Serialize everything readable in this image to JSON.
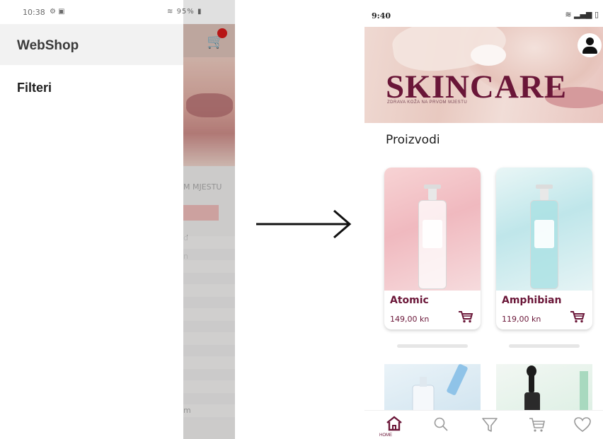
{
  "left_phone": {
    "status": {
      "time": "10:38",
      "right": "95%"
    },
    "drawer": {
      "title": "WebShop",
      "items": [
        "Filteri"
      ]
    },
    "background_fragments": {
      "banner_text": "M MJESTU",
      "line1": "d",
      "line2": "n",
      "line3": "m"
    }
  },
  "right_phone": {
    "status": {
      "time": "9:40"
    },
    "banner": {
      "title": "SKINCARE",
      "subtitle": "ZDRAVA KOŽA NA PRVOM MJESTU"
    },
    "section_title": "Proizvodi",
    "products": [
      {
        "name": "Atomic",
        "price": "149,00 kn"
      },
      {
        "name": "Amphibian",
        "price": "119,00 kn"
      }
    ],
    "bottom_nav": {
      "items": [
        {
          "icon": "home-icon",
          "label": "HOME",
          "active": true
        },
        {
          "icon": "search-icon",
          "active": false
        },
        {
          "icon": "filter-icon",
          "active": false
        },
        {
          "icon": "cart-icon",
          "active": false
        },
        {
          "icon": "heart-icon",
          "active": false
        }
      ]
    },
    "colors": {
      "brand": "#6a1638",
      "accent_badge": "#d11a1a"
    }
  }
}
